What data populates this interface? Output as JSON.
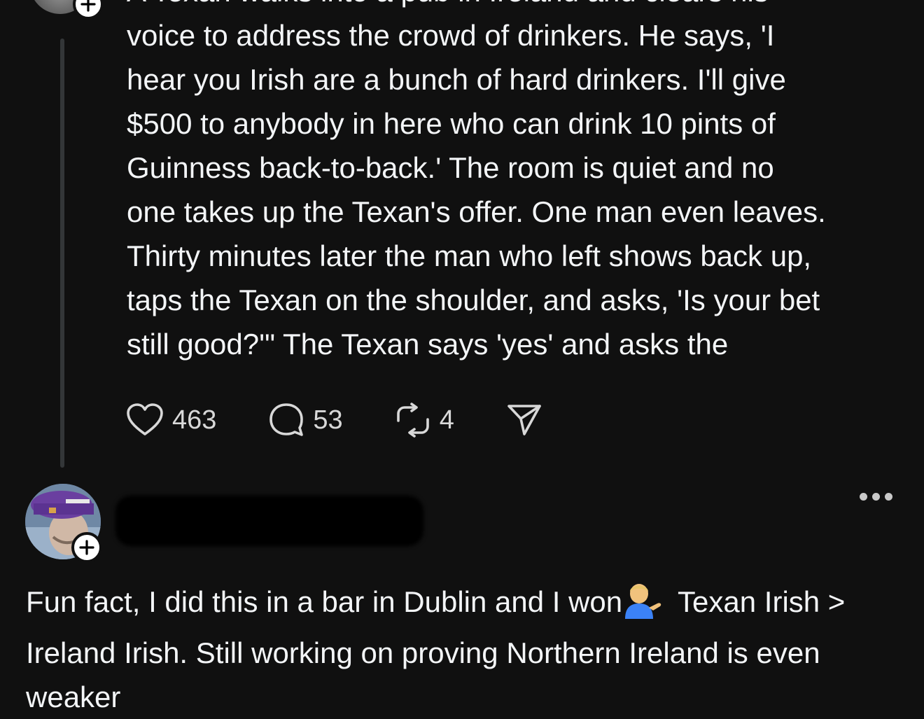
{
  "post": {
    "text": "A Texan walks into a pub in Ireland and clears his\nvoice to address the crowd of drinkers. He says, 'I\nhear you Irish are a bunch of hard drinkers. I'll give\n$500 to anybody in here who can drink 10 pints of\nGuinness back-to-back.' The room is quiet and no\none takes up the Texan's offer. One man even leaves.\nThirty minutes later the man who left shows back up,\ntaps the Texan on the shoulder, and asks, 'Is your bet\nstill good?'\" The Texan says 'yes' and asks the",
    "likes": "463",
    "replies": "53",
    "reposts": "4"
  },
  "reply": {
    "text_before_emoji": "Fun fact, I did this in a bar in Dublin and I won",
    "emoji_name": "person-tipping-hand-emoji",
    "text_after_emoji": " Texan Irish > Ireland Irish. Still working on proving Northern Ireland is even weaker"
  },
  "colors": {
    "background": "#101010",
    "text": "#f3f5f7",
    "muted": "#d8d8d8",
    "thread_line": "#333638"
  }
}
